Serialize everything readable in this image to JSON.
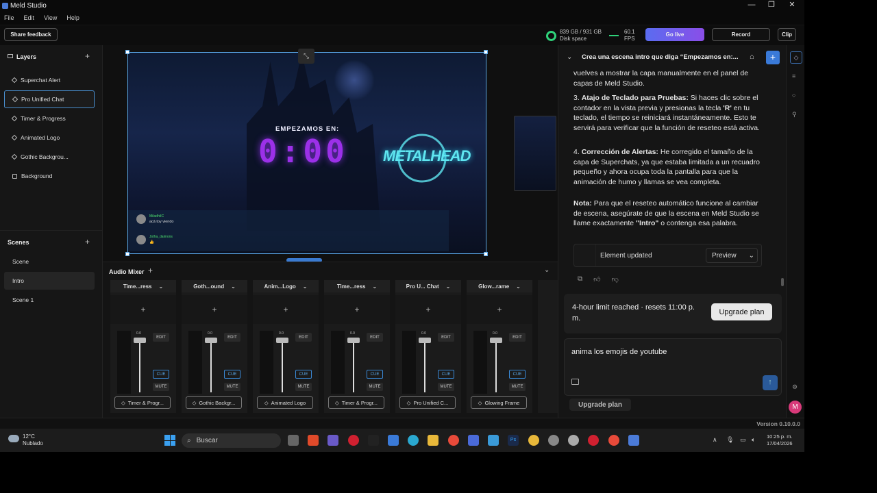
{
  "app": {
    "title": "Meld Studio"
  },
  "window": {
    "minimize": "—",
    "restore": "❐",
    "close": "✕"
  },
  "menu": [
    "File",
    "Edit",
    "View",
    "Help"
  ],
  "toolbar": {
    "share_feedback": "Share feedback",
    "disk_value": "839 GB / 931 GB",
    "disk_label": "Disk space",
    "fps_value": "60.1",
    "fps_label": "FPS",
    "go_live": "Go live",
    "record": "Record",
    "clip": "Clip"
  },
  "layers": {
    "title": "Layers",
    "items": [
      {
        "label": "Superchat Alert",
        "icon": "diamond"
      },
      {
        "label": "Pro Unified Chat",
        "icon": "diamond",
        "selected": true
      },
      {
        "label": "Timer & Progress",
        "icon": "diamond"
      },
      {
        "label": "Animated Logo",
        "icon": "diamond"
      },
      {
        "label": "Gothic Backgrou...",
        "icon": "diamond"
      },
      {
        "label": "Background",
        "icon": "square"
      }
    ]
  },
  "scenes": {
    "title": "Scenes",
    "items": [
      "Scene",
      "Intro",
      "Scene 1"
    ],
    "selected": "Intro"
  },
  "preview": {
    "heading": "EMPEZAMOS EN:",
    "timer": "0:00",
    "logo_text": "METALHEAD",
    "chat": [
      {
        "name": "MiladhtIC",
        "text": "acá toy viendo"
      },
      {
        "name": "Jotha_daimons",
        "text": "👍"
      }
    ]
  },
  "mixer": {
    "title": "Audio Mixer",
    "db": "0.0",
    "edit": "EDIT",
    "cue": "CUE",
    "mute": "MUTE",
    "channels": [
      {
        "head": "Time...ress",
        "source": "Timer & Progr..."
      },
      {
        "head": "Goth...ound",
        "source": "Gothic Backgr..."
      },
      {
        "head": "Anim...Logo",
        "source": "Animated Logo"
      },
      {
        "head": "Time...ress",
        "source": "Timer & Progr..."
      },
      {
        "head": "Pro U... Chat",
        "source": "Pro Unified C..."
      },
      {
        "head": "Glow...rame",
        "source": "Glowing Frame"
      }
    ]
  },
  "assistant": {
    "conversation_title": "Crea una escena intro que diga “Empezamos en:...",
    "p1": "vuelves a mostrar la capa manualmente en el panel de capas de Meld Studio.",
    "p3_num": "3. ",
    "p3_bold": "Atajo de Teclado para Pruebas:",
    "p3_a": " Si haces clic sobre el contador en la vista previa y presionas la tecla ",
    "p3_key": "'R'",
    "p3_b": " en tu teclado, el tiempo se reiniciará instantáneamente. Esto te servirá para verificar que la función de reseteo está activa.",
    "p4_num": "4. ",
    "p4_bold": "Corrección de Alertas:",
    "p4_text": " He corregido el tamaño de la capa de Superchats, ya que estaba limitada a un recuadro pequeño y ahora ocupa toda la pantalla para que la animación de humo y llamas se vea completa.",
    "note_bold": "Nota:",
    "note_a": " Para que el reseteo automático funcione al cambiar de escena, asegúrate de que la escena en Meld Studio se llame exactamente ",
    "note_intro": "\"Intro\"",
    "note_b": " o contenga esa palabra.",
    "element_updated": "Element updated",
    "preview_btn": "Preview",
    "limit_text": "4-hour limit reached · resets 11:00 p. m.",
    "upgrade_btn": "Upgrade plan",
    "input_text": "anima los emojis de youtube",
    "upgrade_link": "Upgrade plan",
    "avatar_letter": "M"
  },
  "status": {
    "version": "Version 0.10.0.0"
  },
  "taskbar": {
    "temp": "12°C",
    "weather": "Nublado",
    "search": "Buscar",
    "time": "10:25 p. m.",
    "date": "17/04/2026"
  }
}
